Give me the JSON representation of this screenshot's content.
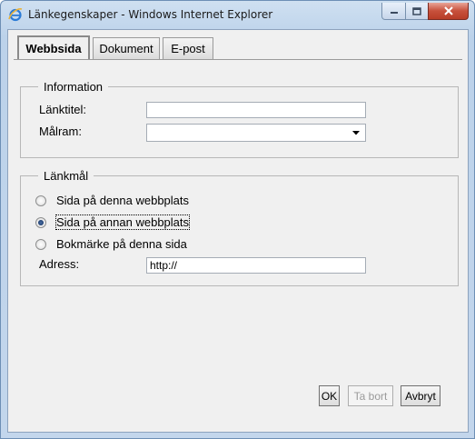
{
  "window": {
    "title": "Länkegenskaper - Windows Internet Explorer"
  },
  "tabs": [
    {
      "label": "Webbsida",
      "active": true
    },
    {
      "label": "Dokument",
      "active": false
    },
    {
      "label": "E-post",
      "active": false
    }
  ],
  "information": {
    "legend": "Information",
    "link_title_label": "Länktitel:",
    "link_title_value": "",
    "target_frame_label": "Målram:",
    "target_frame_value": ""
  },
  "link_target": {
    "legend": "Länkmål",
    "options": [
      {
        "label": "Sida på denna webbplats",
        "checked": false
      },
      {
        "label": "Sida på annan webbplats",
        "checked": true
      },
      {
        "label": "Bokmärke på denna sida",
        "checked": false
      }
    ],
    "address_label": "Adress:",
    "address_value": "http://"
  },
  "buttons": {
    "ok": "OK",
    "remove": "Ta bort",
    "cancel": "Avbryt"
  }
}
